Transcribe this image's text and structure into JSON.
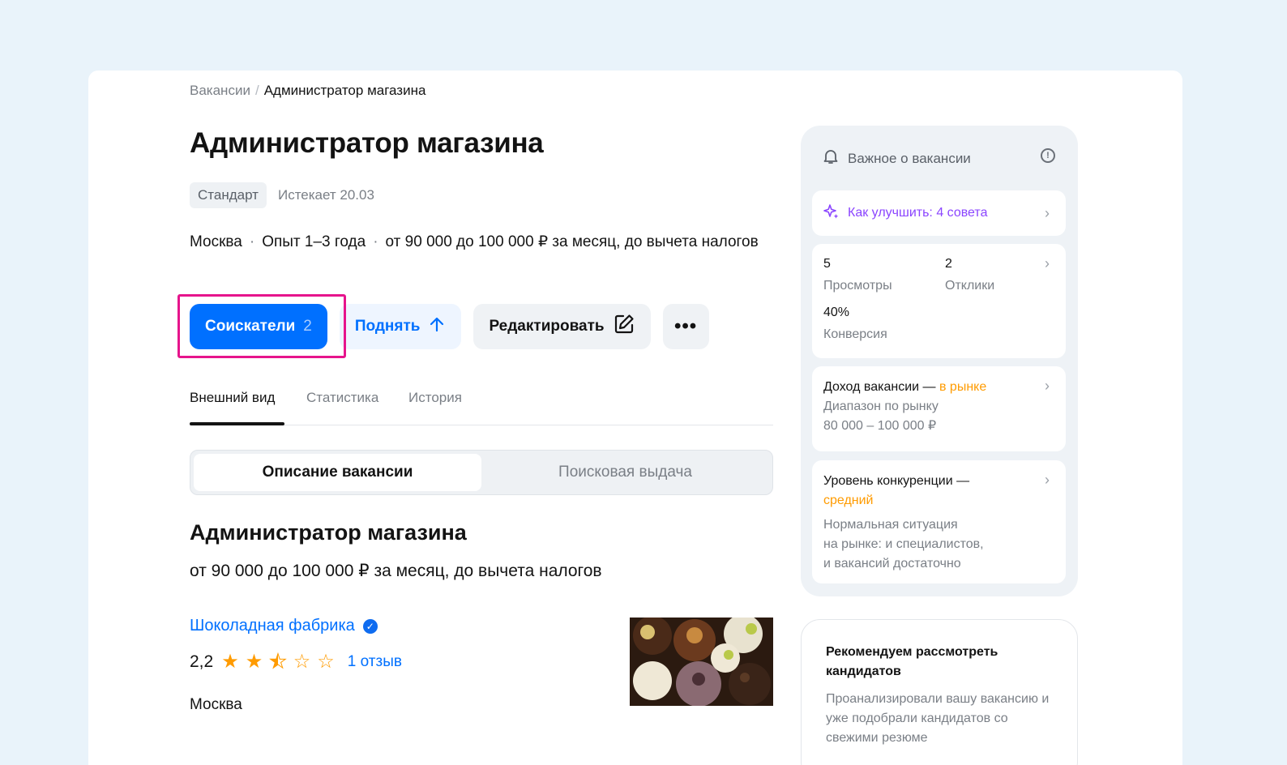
{
  "breadcrumb": {
    "parent": "Вакансии",
    "separator": "/",
    "current": "Администратор магазина"
  },
  "vacancy": {
    "title": "Администратор магазина",
    "plan_badge": "Стандарт",
    "expires": "Истекает 20.03",
    "city": "Москва",
    "experience": "Опыт 1–3 года",
    "salary": "от 90 000 до 100 000 ₽ за месяц, до вычета налогов"
  },
  "actions": {
    "applicants_label": "Соискатели",
    "applicants_count": "2",
    "raise_label": "Поднять",
    "edit_label": "Редактировать"
  },
  "tabs": [
    "Внешний вид",
    "Статистика",
    "История"
  ],
  "segments": [
    "Описание вакансии",
    "Поисковая выдача"
  ],
  "preview": {
    "title": "Администратор магазина",
    "salary": "от 90 000 до 100 000 ₽ за месяц, до вычета налогов",
    "company": "Шоколадная фабрика",
    "rating": "2,2",
    "rating_stars": 2.5,
    "reviews": "1 отзыв",
    "city": "Москва"
  },
  "sidebar": {
    "header": "Важное о вакансии",
    "tip": "Как улучшить: 4 совета",
    "stats": {
      "views_value": "5",
      "views_label": "Просмотры",
      "responses_value": "2",
      "responses_label": "Отклики",
      "conversion_value": "40%",
      "conversion_label": "Конверсия"
    },
    "income": {
      "title": "Доход вакансии —",
      "status": "в рынке",
      "line1": "Диапазон по рынку",
      "line2": "80 000 – 100 000 ₽"
    },
    "competition": {
      "title": "Уровень конкуренции —",
      "status": "средний",
      "line1": "Нормальная ситуация",
      "line2": "на рынке: и специалистов,",
      "line3": "и вакансий достаточно"
    },
    "recommend": {
      "title": "Рекомендуем рассмотреть кандидатов",
      "text": "Проанализировали вашу вакансию и уже подобрали кандидатов со свежими резюме"
    }
  },
  "colors": {
    "accent": "#0070ff",
    "highlight": "#e6148c",
    "warning": "#ff9b00",
    "tip": "#8b45ff"
  }
}
